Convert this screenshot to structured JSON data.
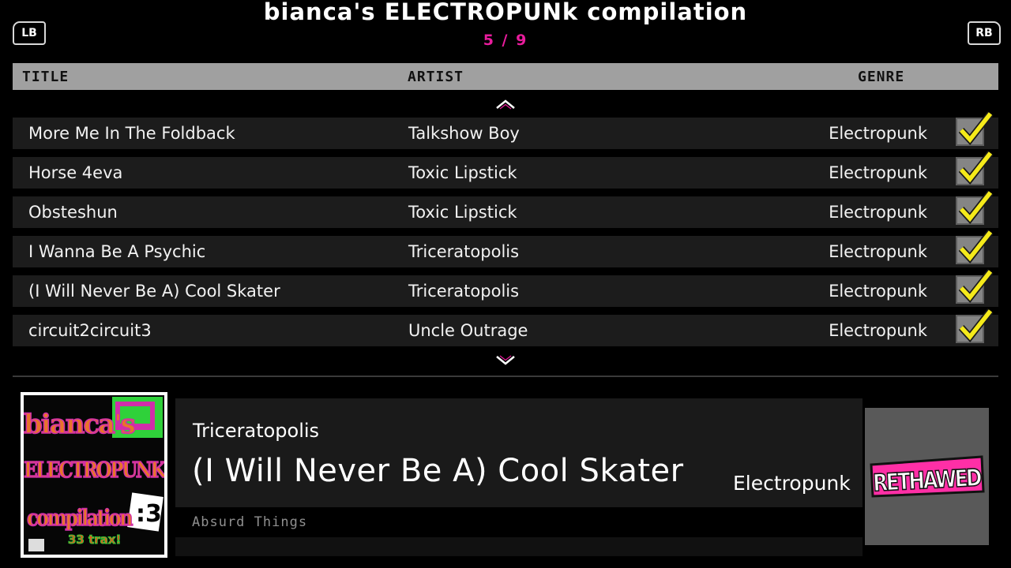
{
  "header": {
    "title": "bianca's ELECTROPUNk compilation",
    "page_counter": "5 / 9",
    "lb_label": "LB",
    "rb_label": "RB"
  },
  "columns": {
    "title": "TITLE",
    "artist": "ARTIST",
    "genre": "GENRE"
  },
  "tracks": [
    {
      "title": "More Me In The Foldback",
      "artist": "Talkshow Boy",
      "genre": "Electropunk",
      "checked": true
    },
    {
      "title": "Horse 4eva",
      "artist": "Toxic Lipstick",
      "genre": "Electropunk",
      "checked": true
    },
    {
      "title": "Obsteshun",
      "artist": "Toxic Lipstick",
      "genre": "Electropunk",
      "checked": true
    },
    {
      "title": "I Wanna Be A Psychic",
      "artist": "Triceratopolis",
      "genre": "Electropunk",
      "checked": true
    },
    {
      "title": "(I Will Never Be A) Cool Skater",
      "artist": "Triceratopolis",
      "genre": "Electropunk",
      "checked": true
    },
    {
      "title": "circuit2circuit3",
      "artist": "Uncle Outrage",
      "genre": "Electropunk",
      "checked": true
    }
  ],
  "now_playing": {
    "artist": "Triceratopolis",
    "title": "(I Will Never Be A) Cool Skater",
    "genre": "Electropunk",
    "album": "Absurd Things"
  },
  "album_art": {
    "line1": "bianca's",
    "line2": "ELECTROPUNK",
    "line3": "compilation",
    "face": ":3",
    "tag": "33 trax!"
  },
  "logo": {
    "text": "RETHAWED"
  },
  "colors": {
    "accent": "#e81c9c",
    "check": "#f5ea1a",
    "header_bar": "#a0a0a0",
    "row_bg": "#1c1c1c",
    "logo_bg": "#595959"
  },
  "icons": {
    "scroll_up": "chevron-up-icon",
    "scroll_down": "chevron-down-icon",
    "checkbox": "check-icon"
  }
}
